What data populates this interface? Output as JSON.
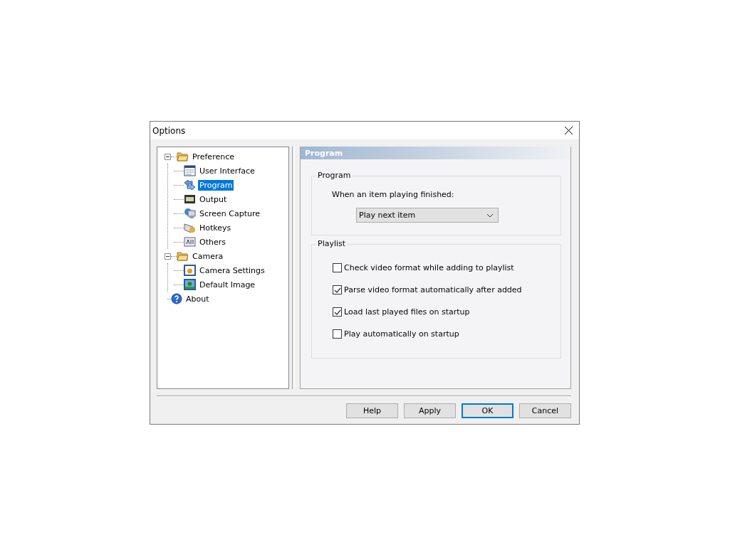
{
  "window": {
    "title": "Options"
  },
  "tree": [
    {
      "label": "Preference",
      "expanded": true,
      "selected": false,
      "children": [
        {
          "label": "User Interface",
          "selected": false
        },
        {
          "label": "Program",
          "selected": true
        },
        {
          "label": "Output",
          "selected": false
        },
        {
          "label": "Screen Capture",
          "selected": false
        },
        {
          "label": "Hotkeys",
          "selected": false
        },
        {
          "label": "Others",
          "selected": false
        }
      ]
    },
    {
      "label": "Camera",
      "expanded": true,
      "selected": false,
      "children": [
        {
          "label": "Camera Settings",
          "selected": false
        },
        {
          "label": "Default Image",
          "selected": false
        }
      ]
    },
    {
      "label": "About",
      "selected": false
    }
  ],
  "page_header": "Program",
  "program_group": {
    "title": "Program",
    "prompt": "When an item playing finished:",
    "dropdown_value": "Play next item"
  },
  "playlist_group": {
    "title": "Playlist",
    "options": [
      {
        "label": "Check video format while adding to playlist",
        "checked": false
      },
      {
        "label": "Parse video format automatically after added",
        "checked": true
      },
      {
        "label": "Load last played files on startup",
        "checked": true
      },
      {
        "label": "Play automatically on startup",
        "checked": false
      }
    ]
  },
  "buttons": [
    {
      "label": "Help",
      "default": false
    },
    {
      "label": "Apply",
      "default": false
    },
    {
      "label": "OK",
      "default": true
    },
    {
      "label": "Cancel",
      "default": false
    }
  ]
}
